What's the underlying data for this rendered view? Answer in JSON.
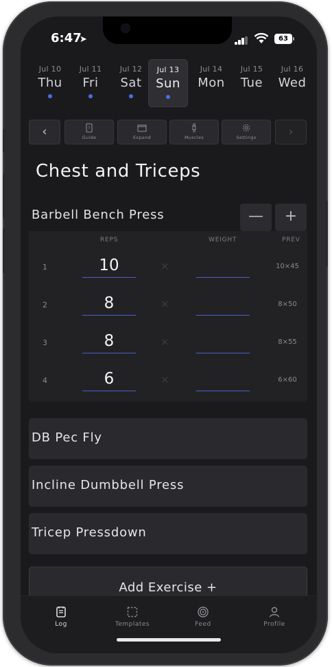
{
  "status": {
    "time": "6:47",
    "battery": "63"
  },
  "days": [
    {
      "date": "Jul 10",
      "name": "Thu",
      "dot": true,
      "selected": false
    },
    {
      "date": "Jul 11",
      "name": "Fri",
      "dot": true,
      "selected": false
    },
    {
      "date": "Jul 12",
      "name": "Sat",
      "dot": true,
      "selected": false
    },
    {
      "date": "Jul 13",
      "name": "Sun",
      "dot": true,
      "selected": true
    },
    {
      "date": "Jul 14",
      "name": "Mon",
      "dot": false,
      "selected": false
    },
    {
      "date": "Jul 15",
      "name": "Tue",
      "dot": false,
      "selected": false
    },
    {
      "date": "Jul 16",
      "name": "Wed",
      "dot": false,
      "selected": false
    }
  ],
  "toolbar": {
    "prev_arrow": "‹",
    "next_arrow": "›",
    "guide_label": "Guide",
    "expand_label": "Expand",
    "muscles_label": "Muscles",
    "settings_label": "Settings"
  },
  "workout_title": "Chest and Triceps",
  "active_exercise": {
    "name": "Barbell Bench Press",
    "minus_label": "—",
    "plus_label": "+",
    "headers": {
      "reps": "REPS",
      "weight": "WEIGHT",
      "prev": "PREV"
    },
    "times_glyph": "×",
    "sets": [
      {
        "num": "1",
        "reps": "10",
        "weight": "",
        "prev": "10×45"
      },
      {
        "num": "2",
        "reps": "8",
        "weight": "",
        "prev": "8×50"
      },
      {
        "num": "3",
        "reps": "8",
        "weight": "",
        "prev": "8×55"
      },
      {
        "num": "4",
        "reps": "6",
        "weight": "",
        "prev": "6×60"
      }
    ]
  },
  "exercises": [
    "DB Pec Fly",
    "Incline Dumbbell Press",
    "Tricep Pressdown"
  ],
  "add_exercise_label": "Add Exercise +",
  "tabs": [
    {
      "label": "Log",
      "icon": "log-icon",
      "active": true
    },
    {
      "label": "Templates",
      "icon": "templates-icon",
      "active": false
    },
    {
      "label": "Feed",
      "icon": "feed-icon",
      "active": false
    },
    {
      "label": "Profile",
      "icon": "profile-icon",
      "active": false
    }
  ],
  "colors": {
    "accent": "#4a6de0",
    "background": "#1a1a1d",
    "card": "#2a2a2e"
  }
}
